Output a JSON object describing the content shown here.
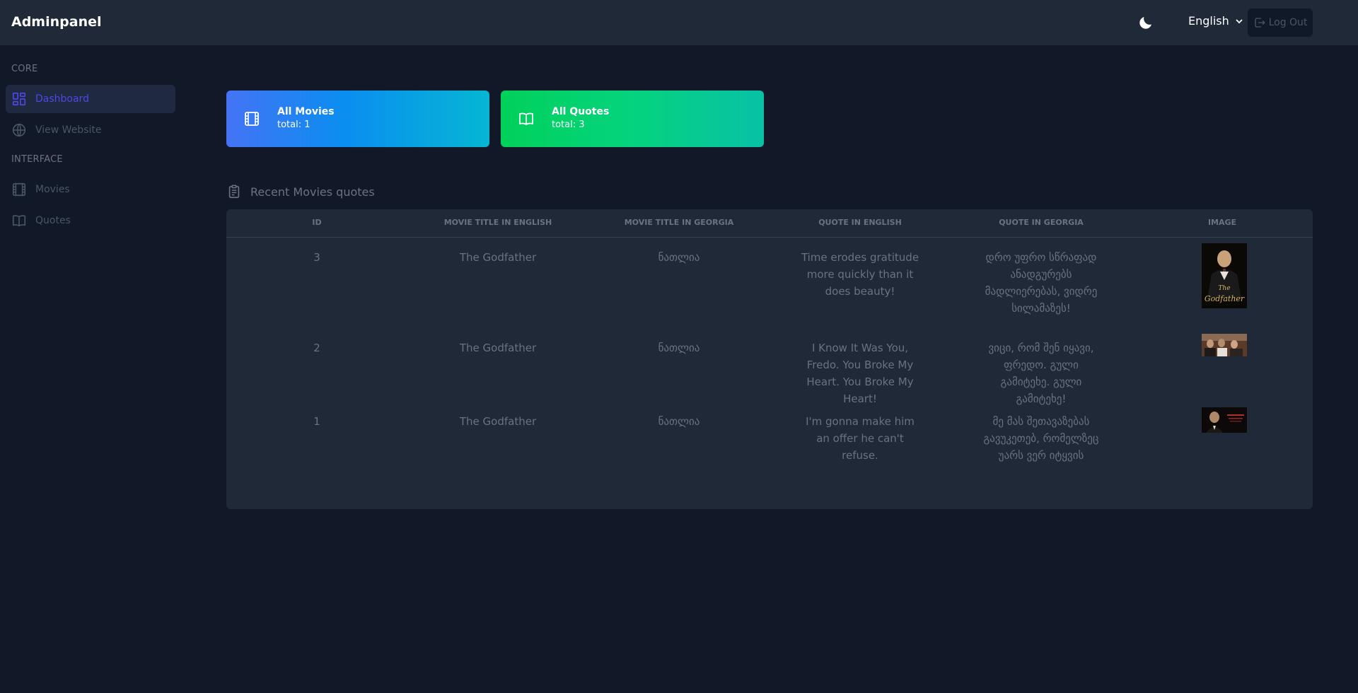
{
  "header": {
    "brand": "Adminpanel",
    "theme_icon": "moon-icon",
    "language": "English",
    "logout_label": "Log Out"
  },
  "sidebar": {
    "sections": [
      {
        "heading": "CORE",
        "items": [
          {
            "label": "Dashboard",
            "icon": "dashboard-icon",
            "active": true
          },
          {
            "label": "View Website",
            "icon": "globe-icon",
            "active": false
          }
        ]
      },
      {
        "heading": "INTERFACE",
        "items": [
          {
            "label": "Movies",
            "icon": "film-icon",
            "active": false
          },
          {
            "label": "Quotes",
            "icon": "book-icon",
            "active": false
          }
        ]
      }
    ]
  },
  "stats": [
    {
      "title": "All Movies",
      "total": "total: 1",
      "icon": "film-icon"
    },
    {
      "title": "All Quotes",
      "total": "total: 3",
      "icon": "book-icon"
    }
  ],
  "recent": {
    "title": "Recent Movies quotes",
    "icon": "clipboard-icon",
    "columns": [
      "ID",
      "MOVIE TITLE IN ENGLISH",
      "MOVIE TITLE IN GEORGIA",
      "QUOTE IN ENGLISH",
      "QUOTE IN GEORGIA",
      "IMAGE"
    ],
    "rows": [
      {
        "id": "3",
        "title_en": "The Godfather",
        "title_ka": "ნათლია",
        "quote_en": "Time erodes gratitude more quickly than it does beauty!",
        "quote_ka": "დრო უფრო სწრაფად ანადგურებს მადლიერებას, ვიდრე სილამაზეს!"
      },
      {
        "id": "2",
        "title_en": "The Godfather",
        "title_ka": "ნათლია",
        "quote_en": "I Know It Was You, Fredo. You Broke My Heart. You Broke My Heart!",
        "quote_ka": "ვიცი, რომ შენ იყავი, ფრედო. გული გამიტეხე. გული გამიტეხე!"
      },
      {
        "id": "1",
        "title_en": "The Godfather",
        "title_ka": "ნათლია",
        "quote_en": "I'm gonna make him an offer he can't refuse.",
        "quote_ka": "მე მას შეთავაზებას გავუკეთებ, რომელზეც უარს ვერ იტყვის"
      }
    ]
  },
  "colors": {
    "background": "#111827",
    "panel": "#1f2937",
    "accent": "#4f46e5",
    "movies_card": "#0a8ef0",
    "quotes_card": "#05d37e"
  }
}
